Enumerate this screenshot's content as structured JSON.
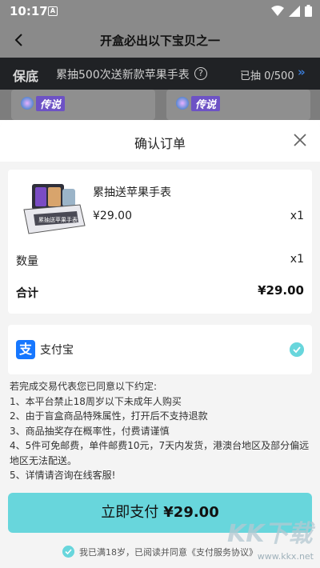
{
  "status_bar": {
    "time": "10:17",
    "indicator": "A"
  },
  "header": {
    "title": "开盒必出以下宝贝之一"
  },
  "guarantee": {
    "tag": "保底",
    "text": "累抽500次送新款苹果手表",
    "help": "?",
    "count": "已抽 0/500",
    "arrow": "»"
  },
  "card_badges": [
    {
      "label": "传说"
    },
    {
      "label": "传说"
    }
  ],
  "sheet": {
    "title": "确认订单",
    "product": {
      "name": "累抽送苹果手表",
      "price": "¥29.00",
      "quantity": "x1",
      "image_caption": "累抽送苹果手表"
    },
    "quantity_label": "数量",
    "quantity_value": "x1",
    "total_label": "合计",
    "total_value": "¥29.00",
    "payment": {
      "icon_glyph": "支",
      "label": "支付宝"
    },
    "terms": [
      "若完成交易代表您已同意以下约定:",
      "1、本平台禁止18周岁以下未成年人购买",
      "2、由于盲盒商品特殊属性，打开后不支持退款",
      "3、商品抽奖存在概率性，付费请谨慎",
      "4、5件可免邮费，单件邮费10元，7天内发货，港澳台地区及部分偏远地区无法配送。",
      "5、详情请咨询在线客服!"
    ],
    "pay_button": {
      "label": "立即支付",
      "amount": "¥29.00"
    },
    "agreement": "我已满18岁，已阅读并同意《支付服务协议》"
  },
  "watermark": {
    "logo": "KK下载",
    "url": "www.kkx.net"
  },
  "colors": {
    "accent": "#68d6dc",
    "alipay": "#1677ff",
    "dark_bar": "#202225",
    "badge": "#6d52c5"
  }
}
